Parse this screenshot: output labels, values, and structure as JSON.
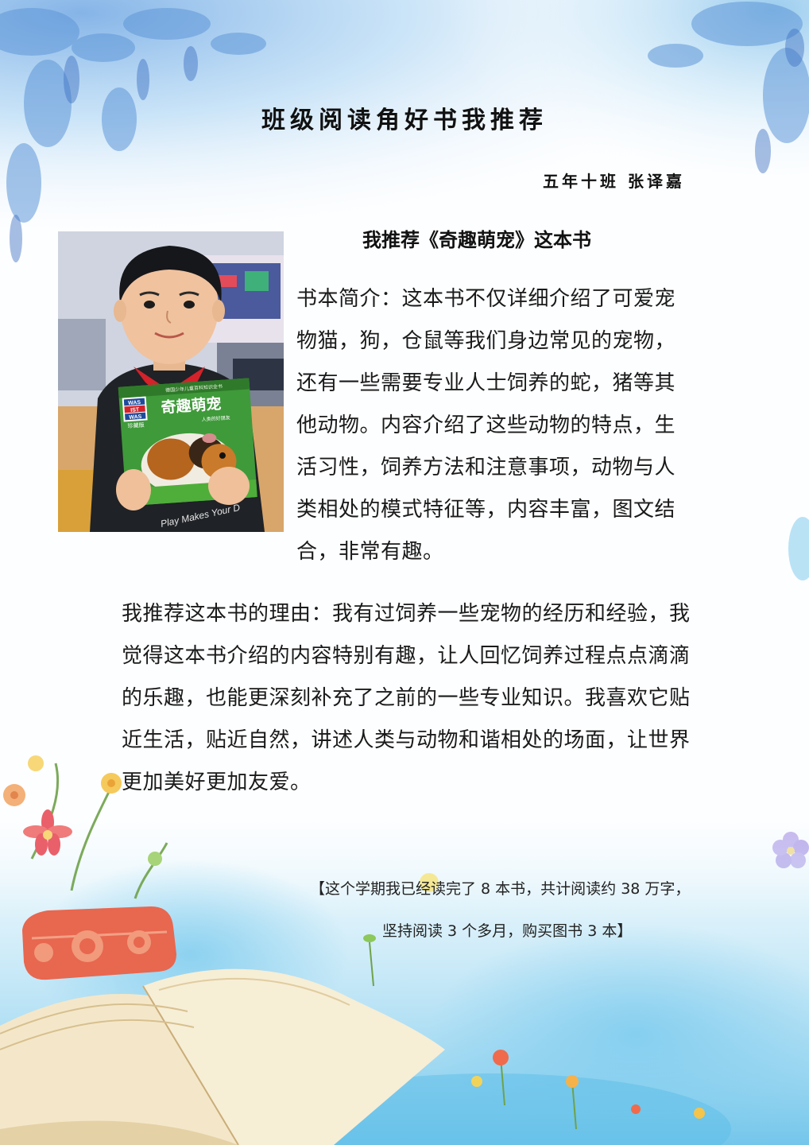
{
  "document": {
    "title": "班级阅读角好书我推荐",
    "author_line": "五年十班  张译嘉",
    "book_heading": "我推荐《奇趣萌宠》这本书",
    "intro_text": "书本简介：这本书不仅详细介绍了可爱宠物猫，狗，仓鼠等我们身边常见的宠物，还有一些需要专业人士饲养的蛇，猪等其他动物。内容介绍了这些动物的特点，生活习性，饲养方法和注意事项，动物与人类相处的模式特征等，内容丰富，图文结合，非常有趣。",
    "reason_text": "我推荐这本书的理由：我有过饲养一些宠物的经历和经验，我觉得这本书介绍的内容特别有趣，让人回忆饲养过程点点滴滴的乐趣，也能更深刻补充了之前的一些专业知识。我喜欢它贴近生活，贴近自然，讲述人类与动物和谐相处的场面，让世界更加美好更加友爱。",
    "summary_line1": "【这个学期我已经读完了 8 本书，共计阅读约 38 万字，",
    "summary_line2": "坚持阅读 3 个多月，购买图书 3 本】"
  },
  "photo": {
    "book_series_lines": [
      "WAS",
      "IST",
      "WAS"
    ],
    "book_title": "奇趣萌宠",
    "book_subtitle": "人类的好朋友",
    "book_top_text": "德国少年儿童百科知识全书",
    "book_small_label": "珍藏版",
    "shirt_text": "Play Makes Your D"
  },
  "colors": {
    "accent_blue": "#6fb4e6",
    "paper": "#fdfeff",
    "book_green": "#3f9a3a"
  }
}
